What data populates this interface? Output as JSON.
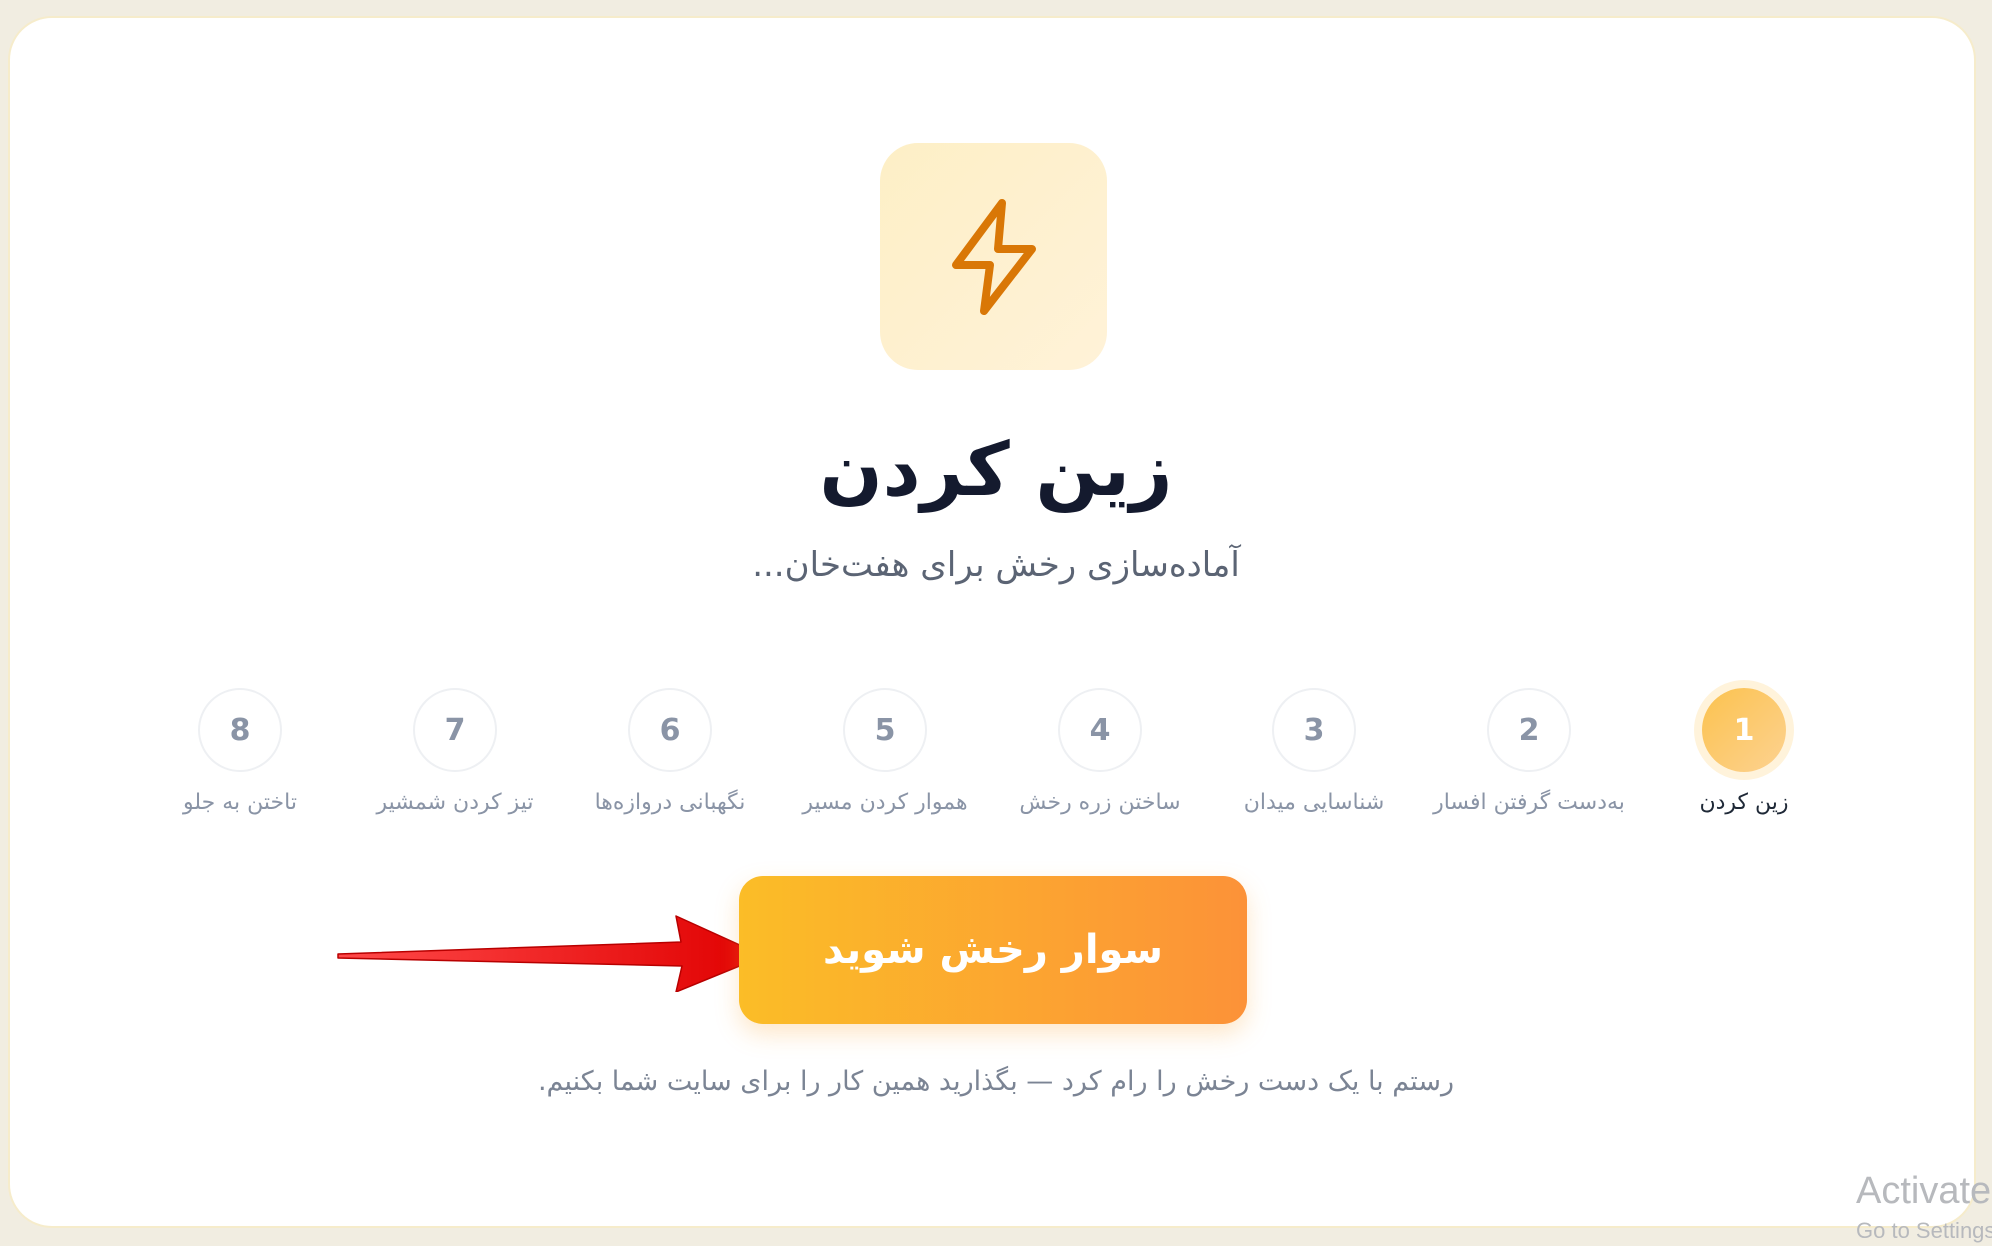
{
  "step_header": {
    "title": "زین کردن",
    "subtitle": "آماده‌سازی رخش برای هفت‌خان..."
  },
  "icon": {
    "name": "lightning-bolt-icon",
    "color": "#d97706"
  },
  "steps": [
    {
      "number": "1",
      "label": "زین کردن",
      "active": true
    },
    {
      "number": "2",
      "label": "به‌دست گرفتن افسار",
      "active": false
    },
    {
      "number": "3",
      "label": "شناسایی میدان",
      "active": false
    },
    {
      "number": "4",
      "label": "ساختن زره رخش",
      "active": false
    },
    {
      "number": "5",
      "label": "هموار کردن مسیر",
      "active": false
    },
    {
      "number": "6",
      "label": "نگهبانی دروازه‌ها",
      "active": false
    },
    {
      "number": "7",
      "label": "تیز کردن شمشیر",
      "active": false
    },
    {
      "number": "8",
      "label": "تاختن به جلو",
      "active": false
    }
  ],
  "cta": {
    "label": "سوار رخش شوید"
  },
  "footnote": "رستم با یک دست رخش را رام کرد — بگذارید همین کار را برای سایت شما بکنیم.",
  "watermark": {
    "line1": "Activate",
    "line2": "Go to Settings"
  },
  "colors": {
    "accent_start": "#fbbd27",
    "accent_end": "#fc9238",
    "title": "#141a2e",
    "muted": "#8a94a6"
  }
}
